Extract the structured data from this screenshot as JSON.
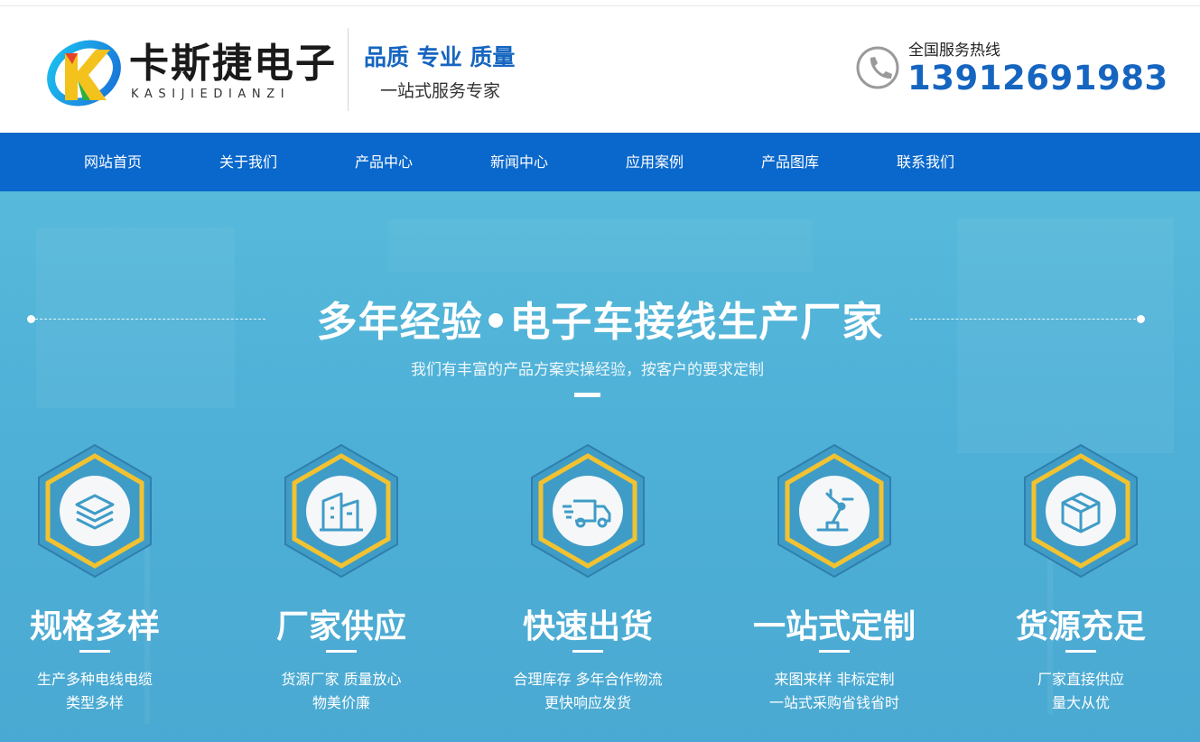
{
  "header": {
    "brand_name": "卡斯捷电子",
    "brand_pinyin": "KASIJIEDIANZI",
    "slogan_main": "品质 专业 质量",
    "slogan_sub": "一站式服务专家",
    "hotline_label": "全国服务热线",
    "hotline_number": "13912691983"
  },
  "nav": {
    "items": [
      {
        "label": "网站首页"
      },
      {
        "label": "关于我们"
      },
      {
        "label": "产品中心"
      },
      {
        "label": "新闻中心"
      },
      {
        "label": "应用案例"
      },
      {
        "label": "产品图库"
      },
      {
        "label": "联系我们"
      }
    ]
  },
  "hero": {
    "title": "多年经验•电子车接线生产厂家",
    "subtitle": "我们有丰富的产品方案实操经验，按客户的要求定制",
    "features": [
      {
        "icon": "layers-icon",
        "title": "规格多样",
        "line1": "生产多种电线电缆",
        "line2": "类型多样"
      },
      {
        "icon": "factory-building-icon",
        "title": "厂家供应",
        "line1": "货源厂家 质量放心",
        "line2": "物美价廉"
      },
      {
        "icon": "delivery-truck-icon",
        "title": "快速出货",
        "line1": "合理库存 多年合作物流",
        "line2": "更快响应发货"
      },
      {
        "icon": "robot-arm-icon",
        "title": "一站式定制",
        "line1": "来图来样 非标定制",
        "line2": "一站式采购省钱省时"
      },
      {
        "icon": "package-box-icon",
        "title": "货源充足",
        "line1": "厂家直接供应",
        "line2": "量大从优"
      }
    ]
  },
  "colors": {
    "accent_blue": "#1565c0",
    "nav_blue": "#0a68cc",
    "hero_blue": "#4fb1d7",
    "hex_gold": "#f2c230"
  }
}
